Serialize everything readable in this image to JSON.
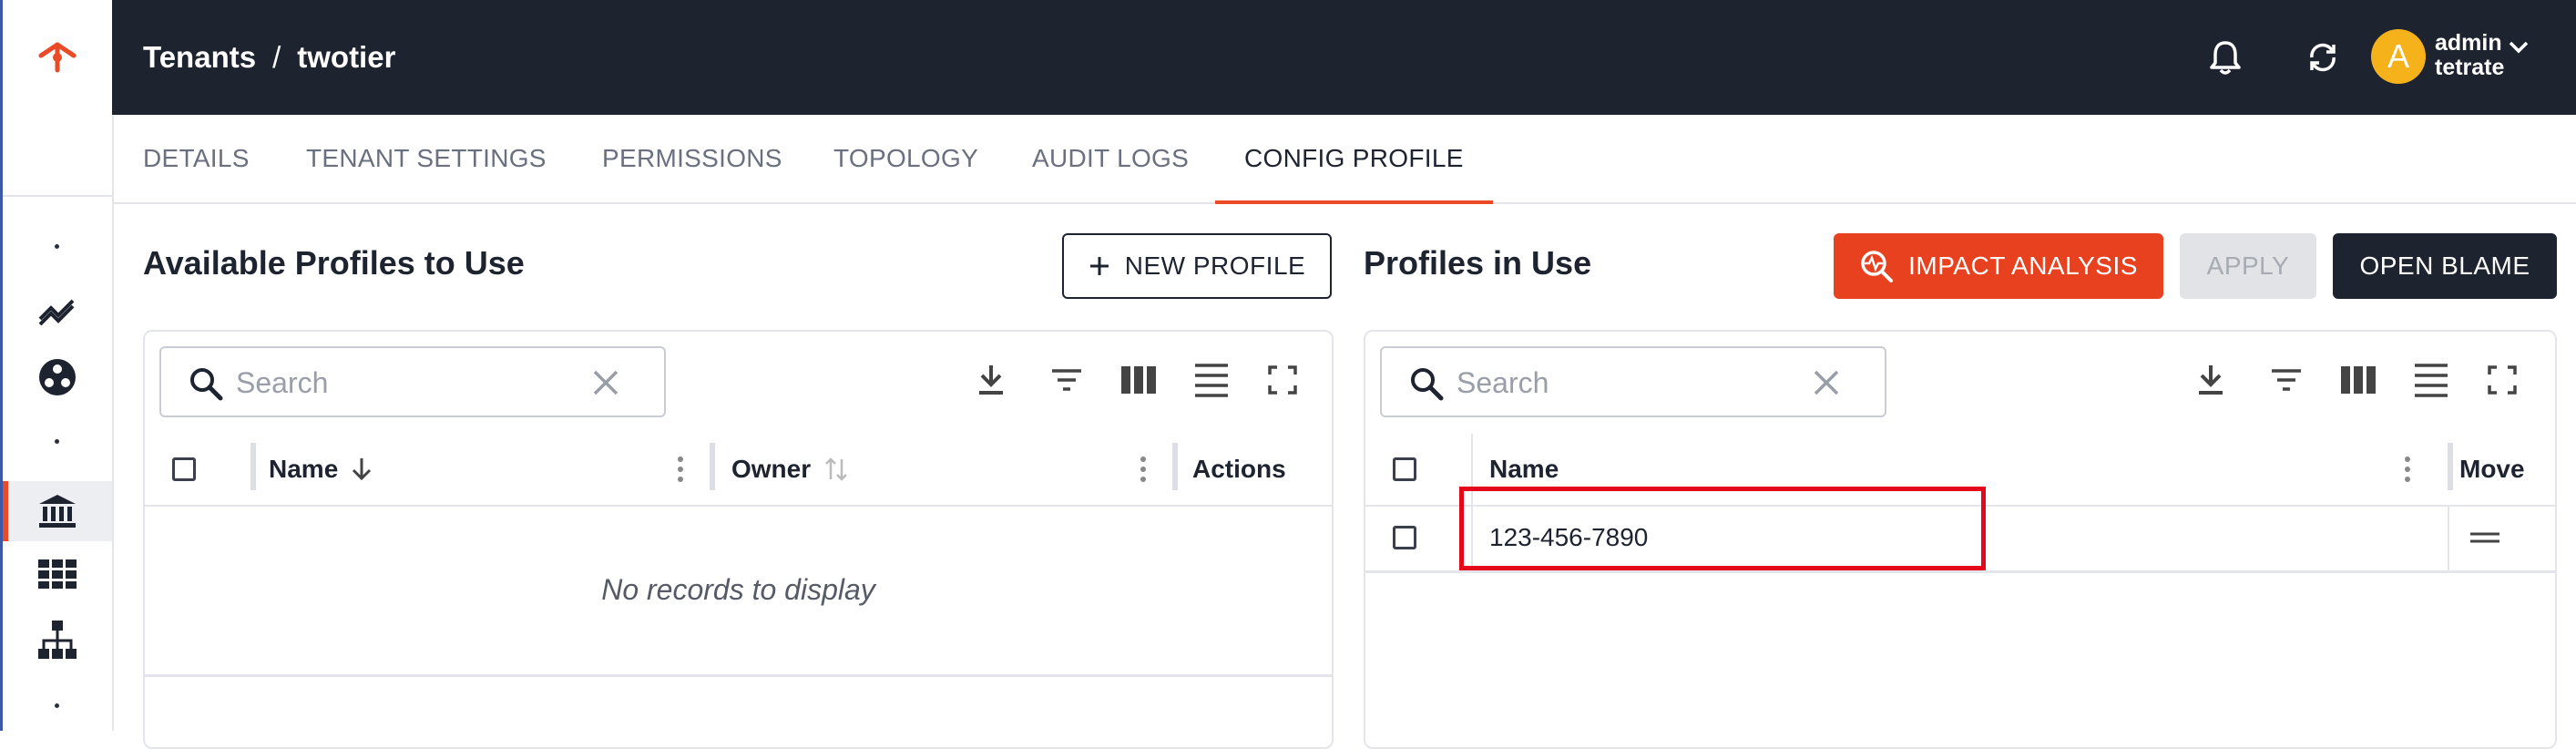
{
  "header": {
    "breadcrumb_root": "Tenants",
    "breadcrumb_sep": "/",
    "breadcrumb_current": "twotier",
    "user": {
      "avatar_letter": "A",
      "name": "admin",
      "org": "tetrate"
    }
  },
  "tabs": [
    {
      "label": "DETAILS"
    },
    {
      "label": "TENANT SETTINGS"
    },
    {
      "label": "PERMISSIONS"
    },
    {
      "label": "TOPOLOGY"
    },
    {
      "label": "AUDIT LOGS"
    },
    {
      "label": "CONFIG PROFILE",
      "active": true
    }
  ],
  "available": {
    "title": "Available Profiles to Use",
    "new_button": "NEW PROFILE",
    "search_placeholder": "Search",
    "columns": {
      "name": "Name",
      "owner": "Owner",
      "actions": "Actions"
    },
    "empty_text": "No records to display"
  },
  "in_use": {
    "title": "Profiles in Use",
    "impact_button": "IMPACT ANALYSIS",
    "apply_button": "APPLY",
    "blame_button": "OPEN BLAME",
    "search_placeholder": "Search",
    "columns": {
      "name": "Name",
      "move": "Move"
    },
    "rows": [
      {
        "name": "123-456-7890"
      }
    ]
  },
  "colors": {
    "accent": "#ea4a26",
    "topbar": "#1e2330",
    "highlight": "#e5071a",
    "avatar": "#f6b21b"
  },
  "icons": [
    "tetrate-logo-icon",
    "bell-icon",
    "sync-icon",
    "chevron-down-icon",
    "search-icon",
    "close-icon",
    "download-icon",
    "filter-icon",
    "columns-icon",
    "density-icon",
    "fullscreen-icon",
    "drag-handle-icon"
  ]
}
